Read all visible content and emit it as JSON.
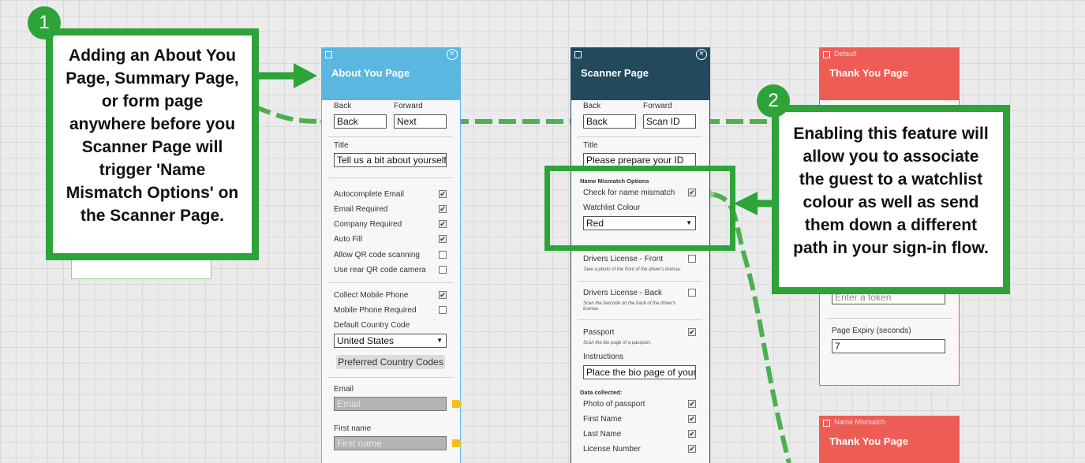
{
  "about_page": {
    "title": "About You Page",
    "back_label": "Back",
    "forward_label": "Forward",
    "back_value": "Back",
    "forward_value": "Next",
    "title_label": "Title",
    "title_value": "Tell us a bit about yourself",
    "options": [
      {
        "label": "Autocomplete Email",
        "checked": true
      },
      {
        "label": "Email Required",
        "checked": true
      },
      {
        "label": "Company Required",
        "checked": true
      },
      {
        "label": "Auto Fill",
        "checked": true
      },
      {
        "label": "Allow QR code scanning",
        "checked": false
      },
      {
        "label": "Use rear QR code camera",
        "checked": false
      }
    ],
    "phone_options": [
      {
        "label": "Collect Mobile Phone",
        "checked": true
      },
      {
        "label": "Mobile Phone Required",
        "checked": false
      }
    ],
    "country_label": "Default Country Code",
    "country_value": "United States",
    "preferred_button": "Preferred Country Codes",
    "email_label": "Email",
    "email_placeholder": "Email",
    "firstname_label": "First name",
    "firstname_placeholder": "First name"
  },
  "scanner_page": {
    "title": "Scanner Page",
    "back_label": "Back",
    "forward_label": "Forward",
    "back_value": "Back",
    "forward_value": "Scan ID",
    "title_label": "Title",
    "title_value": "Please prepare your ID",
    "mismatch_heading": "Name Mismatch Options",
    "mismatch_check_label": "Check for name mismatch",
    "mismatch_checked": true,
    "watchlist_label": "Watchlist Colour",
    "watchlist_value": "Red",
    "dl_front_label": "Drivers License - Front",
    "dl_front_hint": "Take a photo of the front of the driver's license.",
    "dl_front_checked": false,
    "dl_back_label": "Drivers License - Back",
    "dl_back_hint_1": "Scan the barcode on the back of the driver's",
    "dl_back_hint_2": "license.",
    "dl_back_checked": false,
    "passport_label": "Passport",
    "passport_hint": "Scan the bio page of a passport.",
    "passport_checked": true,
    "instructions_label": "Instructions",
    "instructions_value": "Place the bio page of your p",
    "data_heading": "Data collected:",
    "data_items": [
      {
        "label": "Photo of passport",
        "checked": true
      },
      {
        "label": "First Name",
        "checked": true
      },
      {
        "label": "Last Name",
        "checked": true
      },
      {
        "label": "License Number",
        "checked": true
      }
    ]
  },
  "thank_you_default": {
    "tag": "Default",
    "title": "Thank You Page",
    "token_placeholder": "Enter a token",
    "expiry_label": "Page Expiry (seconds)",
    "expiry_value": "7"
  },
  "thank_you_mismatch": {
    "tag": "Name Mismatch",
    "title": "Thank You Page"
  },
  "callout_1": {
    "number": "1",
    "text": "Adding an About You Page, Summary Page, or form page anywhere before you Scanner Page will trigger 'Name Mismatch Options' on the Scanner Page."
  },
  "callout_2": {
    "number": "2",
    "text": "Enabling this feature will allow you to associate the guest to a watchlist colour as well as send them down a different path in your sign-in flow."
  },
  "colors": {
    "about_header": "#5bb6e0",
    "scanner_header": "#22495c",
    "thank_header": "#ee5d55",
    "callout_green": "#2ea33a",
    "connector_green": "#4caf50"
  }
}
